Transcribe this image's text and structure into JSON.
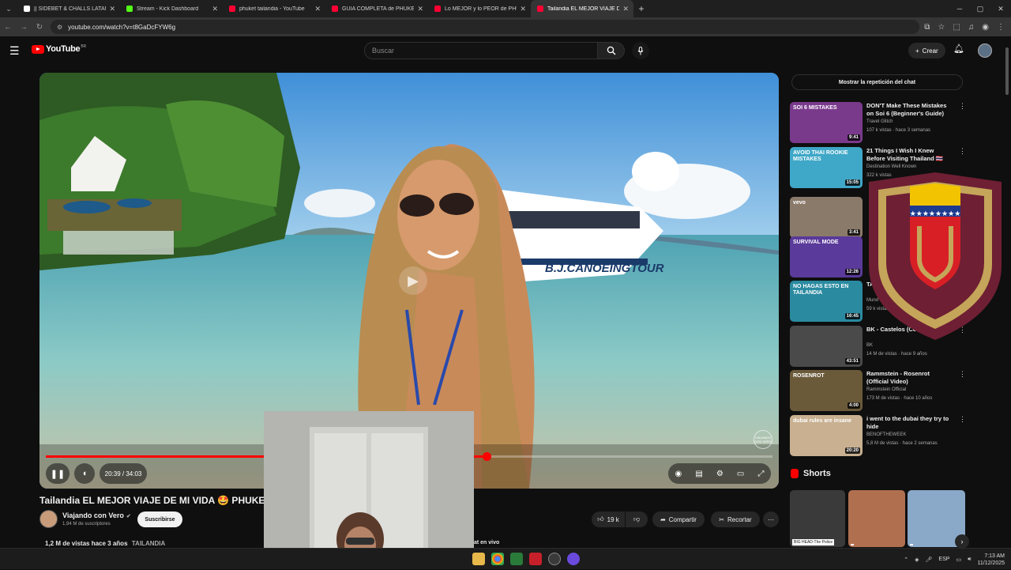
{
  "browser": {
    "tabs": [
      {
        "title": "|| SIDEBET & CHALLS LATAM PA",
        "favicon_color": "#ffffff"
      },
      {
        "title": "Stream - Kick Dashboard",
        "favicon_color": "#53fc18"
      },
      {
        "title": "phuket tailandia - YouTube",
        "favicon_color": "#ff0033"
      },
      {
        "title": "GUÍA COMPLETA de PHUKE",
        "favicon_color": "#ff0033"
      },
      {
        "title": "Lo MEJOR y lo PEOR de PHUKE",
        "favicon_color": "#ff0033"
      },
      {
        "title": "Tailandia EL MEJOR VIAJE DE M",
        "favicon_color": "#ff0033"
      }
    ],
    "active_tab": 5,
    "url": "youtube.com/watch?v=t8GaDcFYW6g"
  },
  "youtube": {
    "logo_text": "YouTube",
    "country_code": "BR",
    "search_placeholder": "Buscar",
    "create_label": "Crear"
  },
  "player": {
    "time": "20:39 / 34:03",
    "progress_fraction": 0.606,
    "watermark": "VIAJANDO CON VERO",
    "boat_text": "B.J.CANOEINGTOUR"
  },
  "video": {
    "title": "Tailandia EL MEJOR VIAJE DE MI VIDA 🤩 PHUKET - Play",
    "channel": "Viajando con Vero",
    "subscribers": "1,94 M de suscriptores",
    "subscribe_label": "Suscribirse",
    "likes": "19 k",
    "share_label": "Compartir",
    "clip_label": "Recortar",
    "views": "1,2 M de vistas",
    "age": "hace 3 años",
    "tag": "TAILANDIA",
    "live_chat_fragment": "at en vivo"
  },
  "sidebar": {
    "chat_replay_label": "Mostrar la repetición del chat",
    "recommendations": [
      {
        "title": "DON'T Make These Mistakes on Soi 6 (Beginner's Guide)",
        "channel": "Travel Glitch",
        "meta": "107 k vistas · hace 3 semanas",
        "duration": "9:41",
        "thumb_color": "#7a3a8c",
        "thumb_text": "SOI 6 MISTAKES"
      },
      {
        "title": "21 Things I Wish I Knew Before Visiting Thailand 🇹🇭",
        "channel": "Destination Well Known",
        "meta": "322 k vistas",
        "duration": "15:05",
        "thumb_color": "#3fa7c7",
        "thumb_text": "AVOID THAI ROOKIE MISTAKES"
      },
      {
        "title": "",
        "channel": "",
        "meta": "",
        "duration": "3:41",
        "thumb_color": "#8a7a6a",
        "thumb_text": "vevo"
      },
      {
        "title": "",
        "channel": "",
        "meta": "",
        "duration": "12:26",
        "thumb_color": "#5a3a9a",
        "thumb_text": "SURVIVAL MODE"
      },
      {
        "title": "TA",
        "channel": "Mund",
        "meta": "59 k vistas",
        "duration": "16:45",
        "thumb_color": "#2a8aa0",
        "thumb_text": "NO HAGAS ESTO EN TAILANDIA"
      },
      {
        "title": "BK - Castelos (Completo)",
        "channel": "BK",
        "meta": "14 M de vistas · hace 9 años",
        "duration": "43:51",
        "thumb_color": "#4a4a4a",
        "thumb_text": ""
      },
      {
        "title": "Rammstein - Rosenrot (Official Video)",
        "channel": "Rammstein Official",
        "meta": "173 M de vistas · hace 10 años",
        "duration": "4:00",
        "thumb_color": "#6a5a3a",
        "thumb_text": "ROSENROT"
      },
      {
        "title": "i went to the dubai they try to hide",
        "channel": "BENOFTHEWEEK",
        "meta": "5,8 M de vistas · hace 2 semanas",
        "duration": "20:20",
        "thumb_color": "#c8b090",
        "thumb_text": "dubai rules are insane"
      }
    ],
    "shorts_label": "Shorts",
    "shorts": [
      {
        "caption": "BIG HEAD-The Police",
        "color": "#3a3a3a"
      },
      {
        "caption": "",
        "color": "#b07050"
      },
      {
        "caption": "",
        "color": "#8aa8c8"
      }
    ]
  },
  "taskbar": {
    "language": "ESP",
    "time": "7:13 AM",
    "date": "11/12/2025"
  }
}
